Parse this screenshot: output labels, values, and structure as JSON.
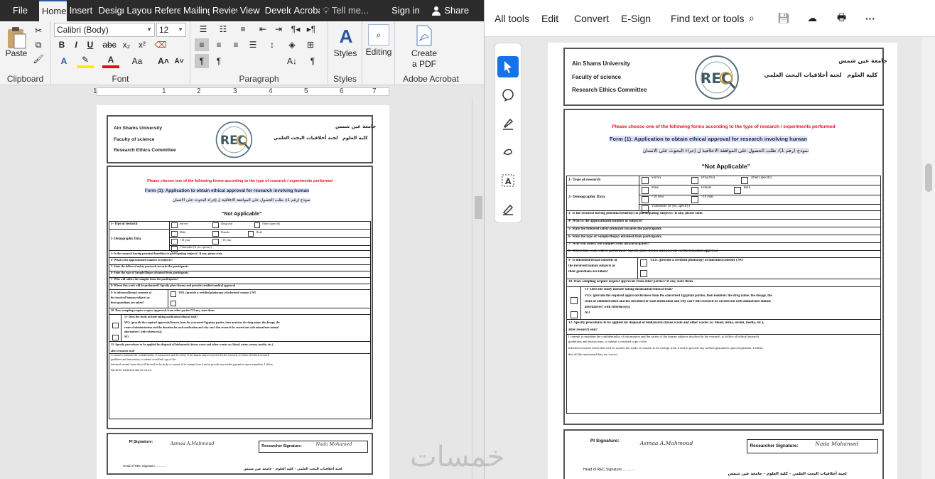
{
  "word": {
    "menu_tabs": [
      "File",
      "Home",
      "Insert",
      "Design",
      "Layout",
      "References",
      "Mailings",
      "Review",
      "View",
      "Developer",
      "Acrobat"
    ],
    "tell_me": "Tell me...",
    "sign_in": "Sign in",
    "share": "Share",
    "ribbon": {
      "paste": "Paste",
      "clipboard": "Clipboard",
      "font_name": "Calibri (Body)",
      "font_size": "12",
      "font": "Font",
      "paragraph": "Paragraph",
      "styles_btn": "Styles",
      "styles": "Styles",
      "editing": "Editing",
      "create_pdf_1": "Create",
      "create_pdf_2": "a PDF",
      "adobe_acrobat": "Adobe Acrobat"
    },
    "ruler_numbers": [
      "1",
      "1",
      "2",
      "3",
      "4",
      "5",
      "6",
      "7"
    ]
  },
  "acrobat": {
    "menu": [
      "All tools",
      "Edit",
      "Convert",
      "E-Sign"
    ],
    "find": "Find text or tools",
    "more": "···"
  },
  "doc": {
    "uni_en": "Ain Shams University",
    "faculty_en": "Faculty of science",
    "committee_en": "Research  Ethics  Committee",
    "uni_ar": "جامعة عين شمس",
    "faculty_ar": "كلية العلوم",
    "committee_ar": "لجنة أخلاقيات البحث العلمي",
    "logo_text": "REC",
    "choose": "Please choose one of the following forms according to the type of research / experiments performed",
    "form_title": "Form (1): Application to obtain ethical approval for research involving human",
    "form_title_ar": "نموذج (رقم 1): طلب الحصول على الموافقة الاخلاقية ل إجراء البحوث على الانسان",
    "not_applicable": "“Not Applicable”",
    "type_of_research": "1- Type of research",
    "survey": "Survey",
    "drug_trial": "Drug trial",
    "other": "Other (specify)",
    "demographic": "2- Demographic Data",
    "male": "Male",
    "female": "Female",
    "both": "Both",
    "lt18": "<18 year",
    "gt18": ">18 year",
    "vulnerable": "Vulnerable (if yes, specify)",
    "q3": "3- Is the research having potential benefit(s) to participating subjects? If any, please state.",
    "q4": "4- What is the approximated number of subjects?",
    "q5": "5- State the followed safety protocols towards the participants.",
    "q6": "6- State the type of Sample/Biopsy obtained from participants.",
    "q7": "7- Who will collect the samples from the participants?",
    "q8": "8- Where this work will be performed? Specify place license and provide certified medical approval",
    "q9_1": "9- Is informed/broad consents of",
    "q9_2": "the involved human subjects or",
    "q9_3": "their guardians are taken?",
    "q9_yes": "YES. (provide a certified photocopy of informed consent ) NO",
    "q10": "10- Does sampling require request approvals from other parties?   If any, state them.",
    "q11": "11- Does the study include taking medication/clinical trial?",
    "q11_yes_1": "YES. (provide the required approvals/licenses from the concerned Egyptian parties, then mention: the drug name, the dosage, the",
    "q11_yes_2": "route of administration and the duration for such medication and why can’t this research be carried out with animal/non-animal",
    "q11_yes_3": "alternatives? with reference(s)).",
    "q11_no": "NO",
    "q12_1": "12- Specify procedures to be applied for disposal of biohazards (tissue waste and other wastes as: blood, urine, serum, media,           etc.),",
    "q12_2": "after research end?",
    "commit_1": "I commit to maintain the confidentiality of information and the safety of the human subjects involved in the research, to follow all ethical research",
    "commit_2": "guidelines and instructions, to submit a certified copy of the",
    "commit_3": "informed consent forms that will be used in the study or consent to be exempt from it and to provide any needed guarantees upon requisition. I affirm",
    "commit_4": "that all the mentioned data are correct.",
    "pi_sig": "PI Signature:",
    "pi_name": "Asmaa A.Mahmoud",
    "researcher_sig": "Researcher Signature:",
    "researcher_name": "Nada Mohamed",
    "head": "Head of REC Signature ……….",
    "footer_ar": "لجنة أخلاقيات البحث العلمي - كلية العلوم - جامعة عين شمس"
  },
  "watermark": "خمسات",
  "colors": {
    "word_dark": "#2b2b2b",
    "word_accent": "#2b579a",
    "acro_blue": "#1473e6",
    "red": "#e0141e"
  }
}
